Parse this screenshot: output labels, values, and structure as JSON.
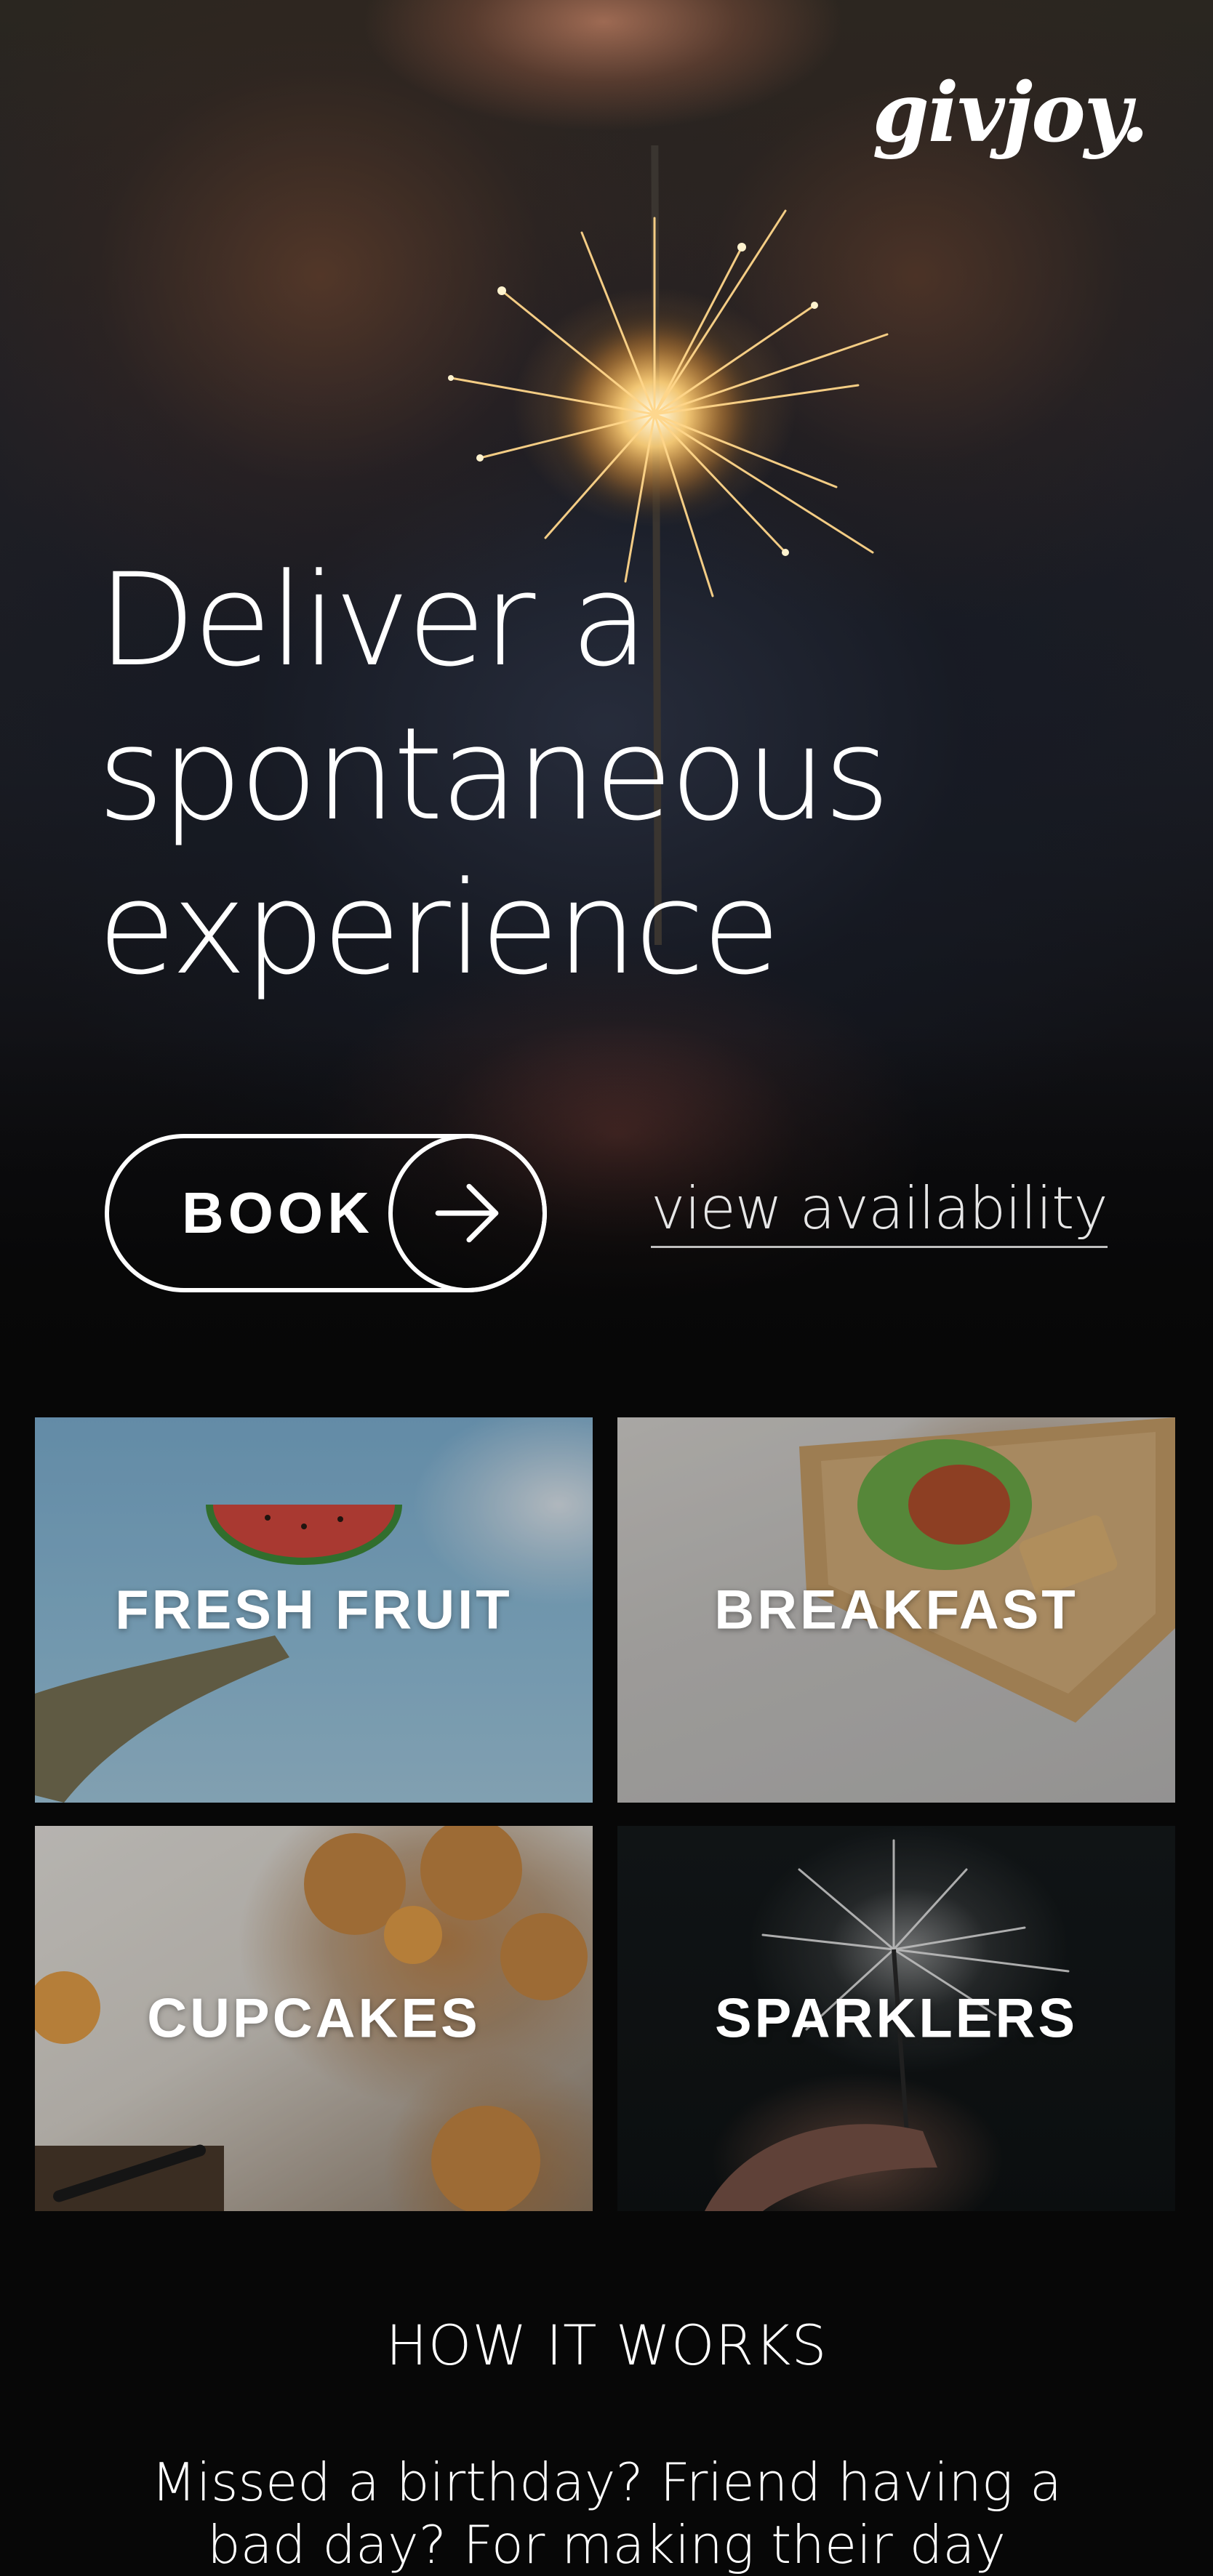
{
  "brand": {
    "logo": "givjoy."
  },
  "hero": {
    "headline_lines": [
      "Deliver a",
      "spontaneous",
      "experience"
    ],
    "book_label": "BOOK",
    "arrow_icon": "arrow-right-icon",
    "view_availability": "view availability"
  },
  "tiles": [
    {
      "label": "FRESH FRUIT"
    },
    {
      "label": "BREAKFAST"
    },
    {
      "label": "CUPCAKES"
    },
    {
      "label": "SPARKLERS"
    }
  ],
  "how_it_works": {
    "title": "HOW IT WORKS",
    "body": "Missed a birthday? Friend having a bad day? For making their day"
  },
  "colors": {
    "background": "#070707",
    "text": "#ffffff",
    "muted_text": "#e6e6e6"
  }
}
